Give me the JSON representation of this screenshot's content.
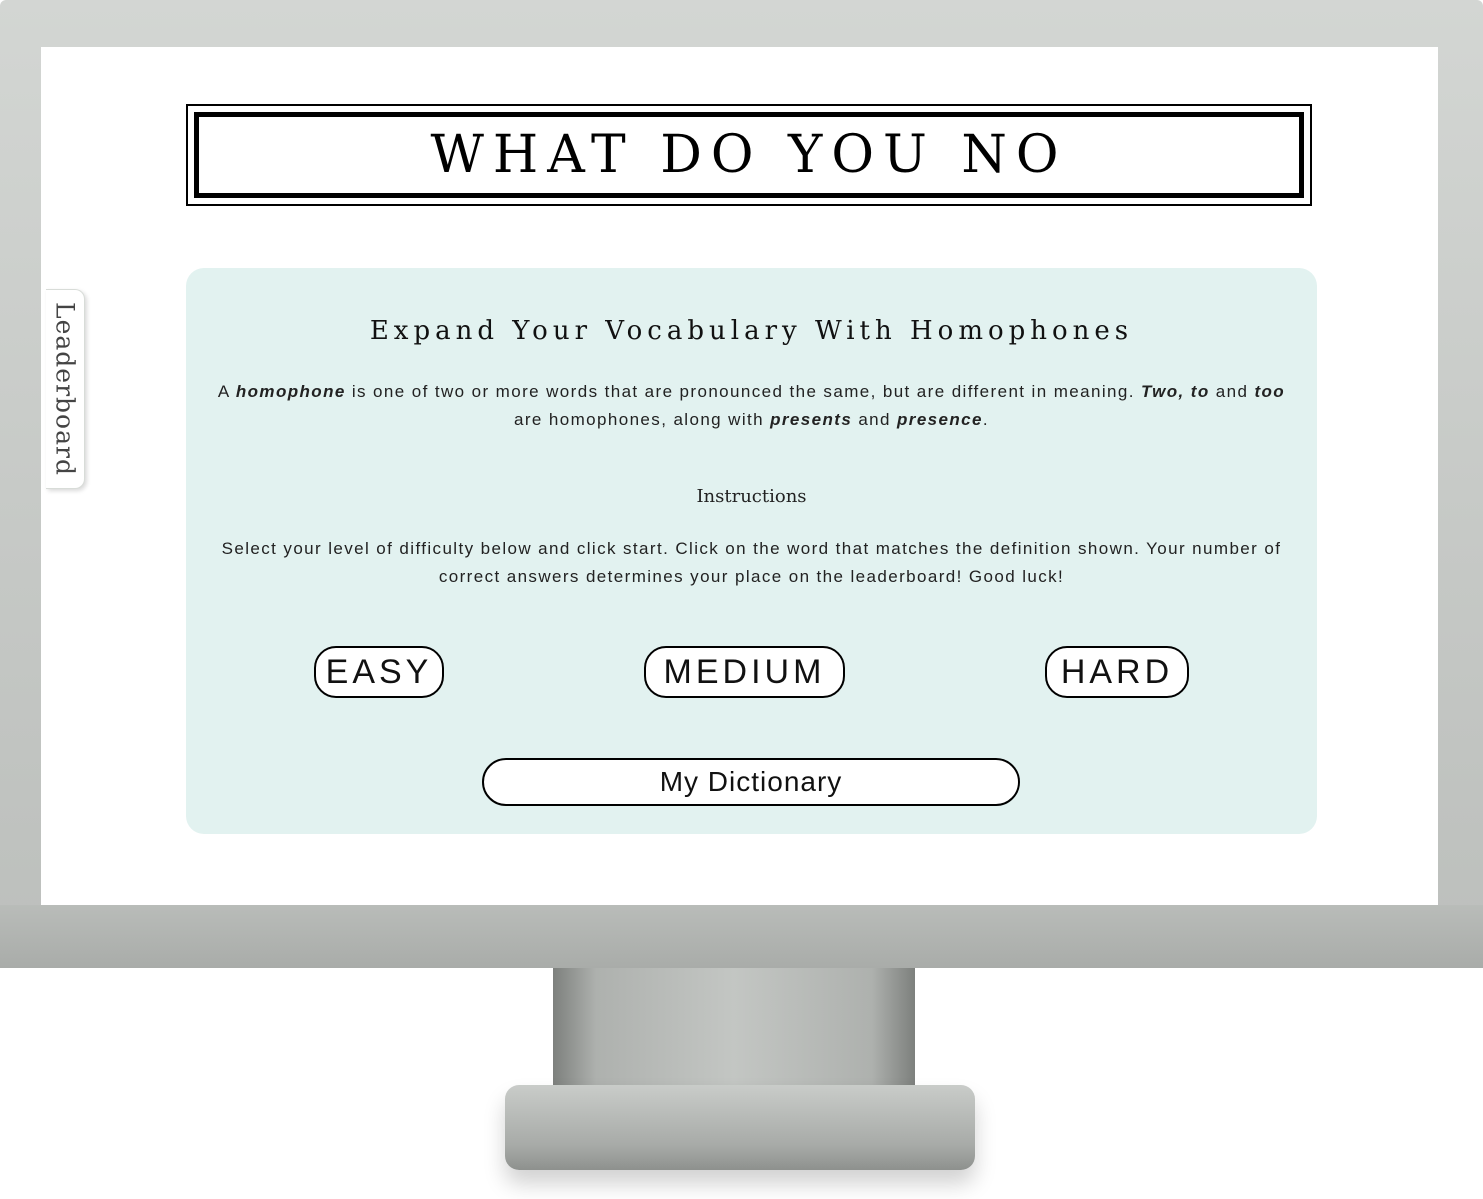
{
  "header": {
    "title": "WHAT DO YOU NO"
  },
  "sidebar": {
    "leaderboard_label": "Leaderboard"
  },
  "main": {
    "heading": "Expand Your Vocabulary With Homophones",
    "intro": {
      "p1": "A ",
      "b1": "homophone",
      "p2": " is one of two or more words that are pronounced the same, but are different in meaning. ",
      "b2": "Two, to",
      "p3": " and ",
      "b3": "too",
      "p4": " are homophones, along with ",
      "b4": "presents",
      "p5": " and ",
      "b5": "presence",
      "p6": "."
    },
    "instructions_heading": "Instructions",
    "instructions_text": "Select your level of difficulty below and click start. Click on the word that matches the definition shown. Your number of correct answers determines your place on the leaderboard! Good luck!"
  },
  "buttons": {
    "easy": "EASY",
    "medium": "MEDIUM",
    "hard": "HARD",
    "dictionary": "My Dictionary"
  },
  "colors": {
    "panel_background": "#e2f2f0",
    "text": "#111111",
    "monitor_bezel": "#c6c9c6"
  }
}
